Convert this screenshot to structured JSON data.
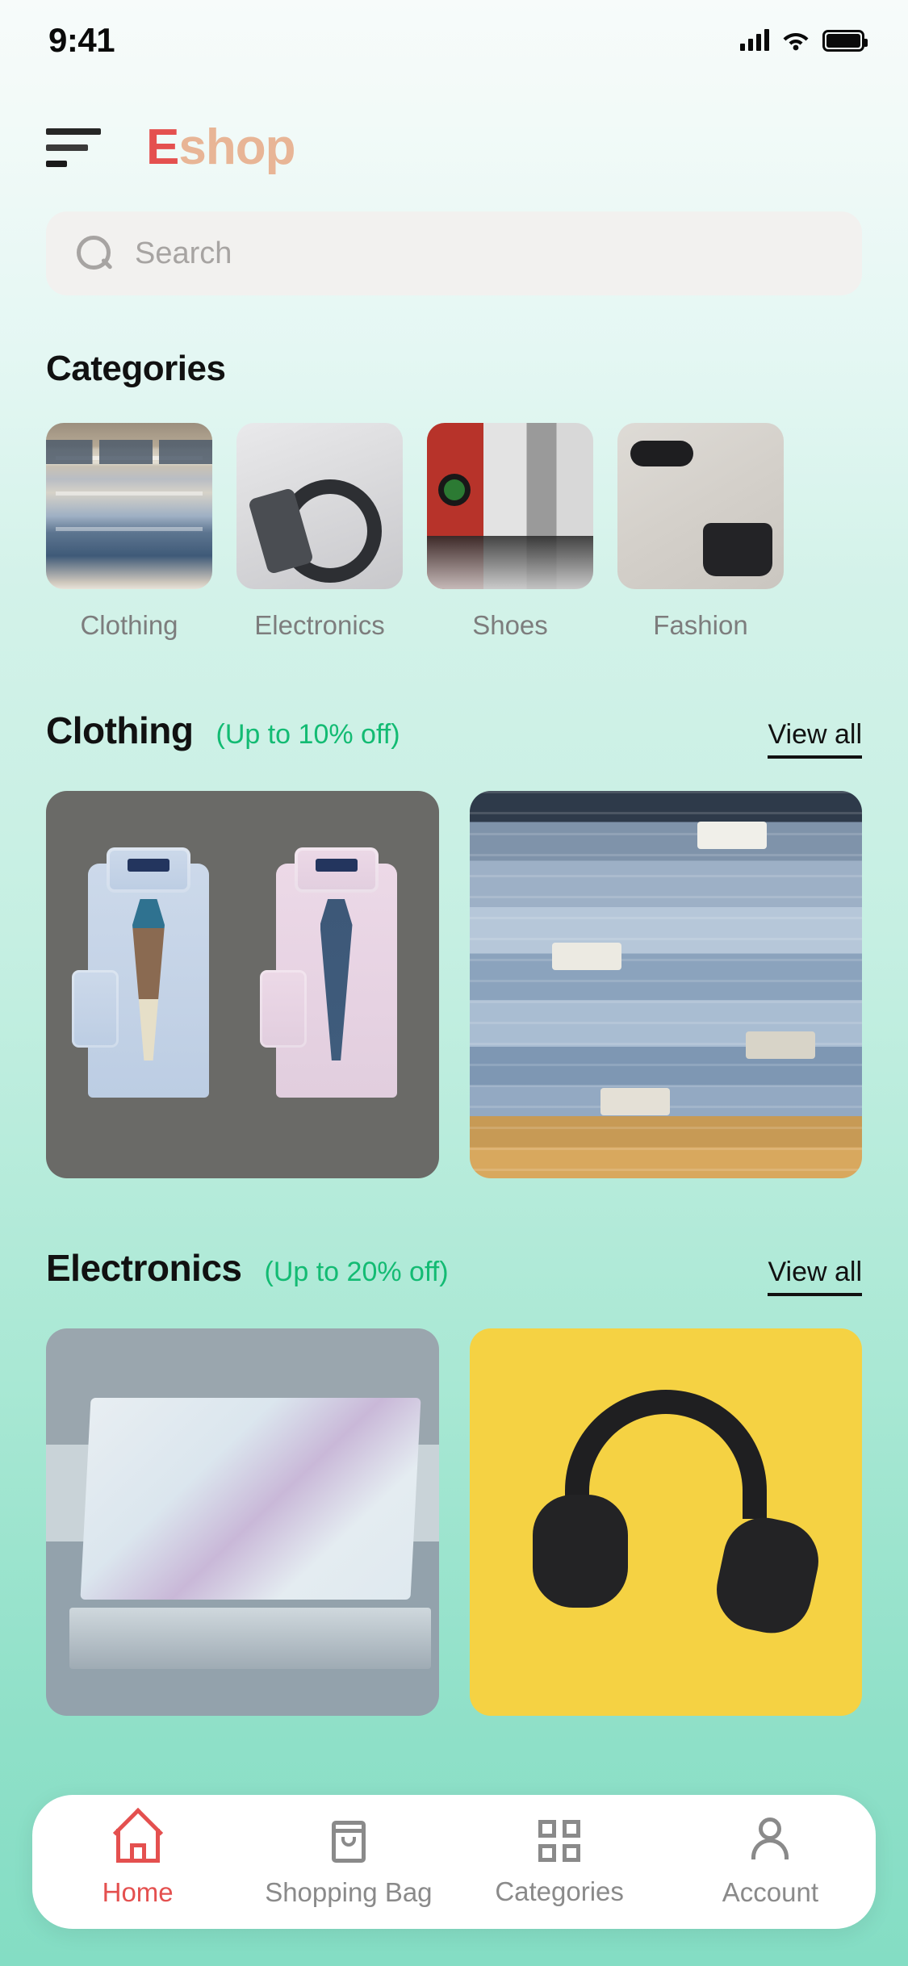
{
  "status_bar": {
    "time": "9:41",
    "signal_icon": "cellular-signal-icon",
    "wifi_icon": "wifi-icon",
    "battery_icon": "battery-full-icon"
  },
  "header": {
    "menu_icon": "hamburger-menu-icon",
    "logo_first": "E",
    "logo_rest": "shop",
    "logo_color_first": "#e4504f",
    "logo_color_rest": "#e8b596"
  },
  "search": {
    "icon": "search-icon",
    "placeholder": "Search",
    "value": ""
  },
  "categories_section": {
    "title": "Categories",
    "items": [
      {
        "label": "Clothing",
        "thumb": "clothing-store-rack-image"
      },
      {
        "label": "Electronics",
        "thumb": "headphones-phone-desk-image"
      },
      {
        "label": "Shoes",
        "thumb": "sneakers-row-image"
      },
      {
        "label": "Fashion",
        "thumb": "accessories-flatlay-image"
      }
    ]
  },
  "sections": [
    {
      "title": "Clothing",
      "discount": "(Up to 10% off)",
      "view_all": "View all",
      "products": [
        {
          "name": "dress-shirts-with-ties-image"
        },
        {
          "name": "stacked-jeans-image"
        }
      ]
    },
    {
      "title": "Electronics",
      "discount": "(Up to 20% off)",
      "view_all": "View all",
      "products": [
        {
          "name": "laptop-on-desk-image"
        },
        {
          "name": "headphones-yellow-background-image"
        }
      ]
    }
  ],
  "bottom_nav": {
    "items": [
      {
        "label": "Home",
        "icon": "home-icon",
        "active": true
      },
      {
        "label": "Shopping Bag",
        "icon": "shopping-bag-icon",
        "active": false
      },
      {
        "label": "Categories",
        "icon": "grid-icon",
        "active": false
      },
      {
        "label": "Account",
        "icon": "user-icon",
        "active": false
      }
    ],
    "active_color": "#e4504f",
    "inactive_color": "#8a8a8a"
  },
  "theme": {
    "accent_red": "#e4504f",
    "accent_peach": "#e8b596",
    "discount_green": "#13bb73",
    "background_top": "#f7fbfa",
    "background_bottom": "#84ddc4"
  }
}
